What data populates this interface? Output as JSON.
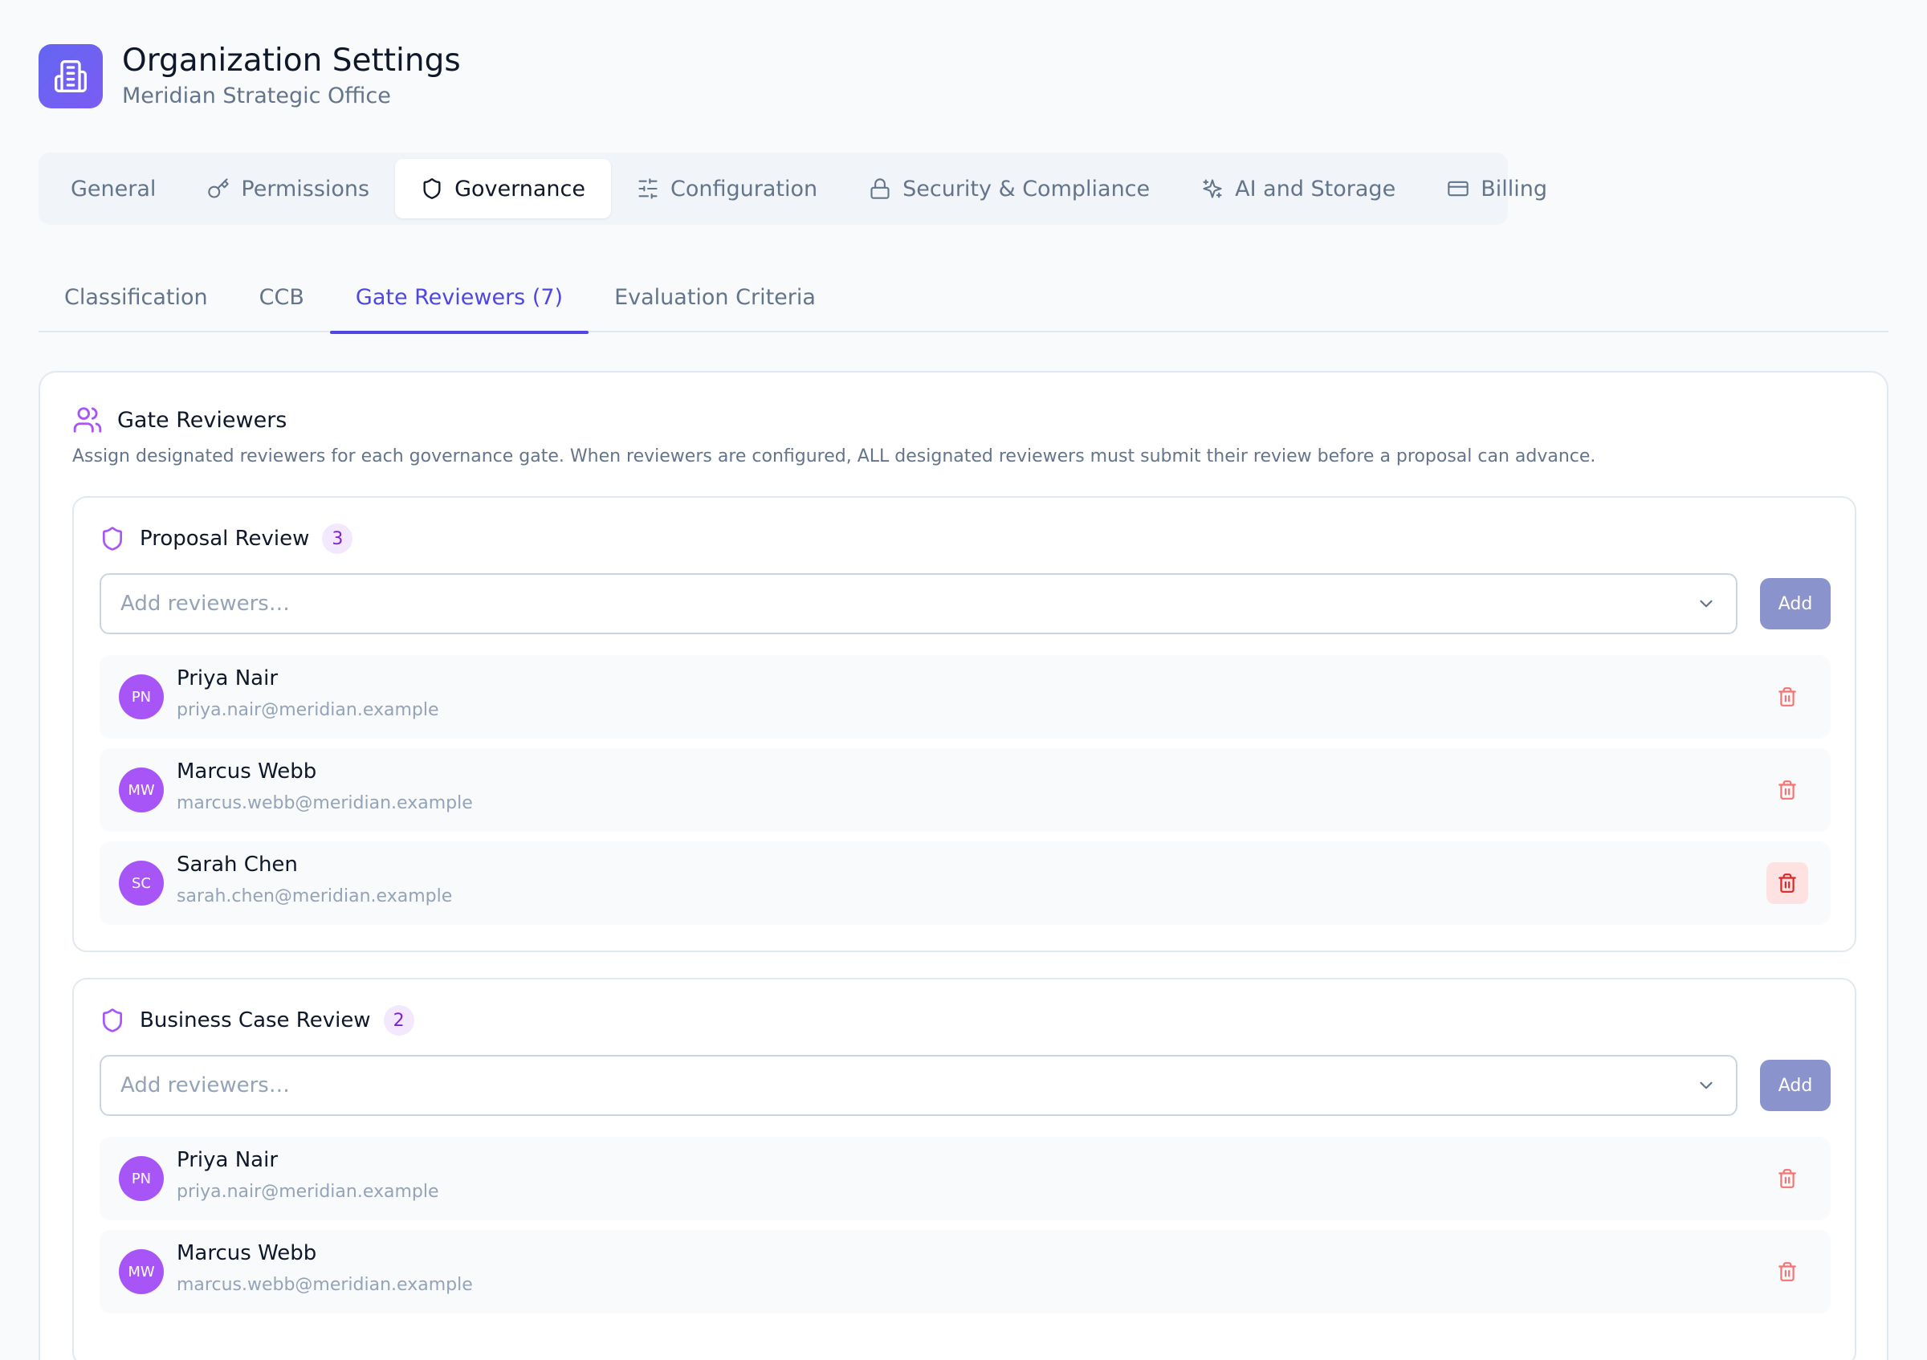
{
  "header": {
    "title": "Organization Settings",
    "subtitle": "Meridian Strategic Office",
    "icon": "building-icon",
    "accent": "#6366f1"
  },
  "main_tabs": [
    {
      "label": "General",
      "icon": ""
    },
    {
      "label": "Permissions",
      "icon": "key-icon"
    },
    {
      "label": "Governance",
      "icon": "shield-icon",
      "active": true
    },
    {
      "label": "Configuration",
      "icon": "sliders-icon"
    },
    {
      "label": "Security & Compliance",
      "icon": "lock-icon"
    },
    {
      "label": "AI and Storage",
      "icon": "sparkles-icon"
    },
    {
      "label": "Billing",
      "icon": "credit-card-icon"
    }
  ],
  "sub_tabs": [
    {
      "label": "Classification"
    },
    {
      "label": "CCB"
    },
    {
      "label": "Gate Reviewers (7)",
      "active": true
    },
    {
      "label": "Evaluation Criteria"
    }
  ],
  "card": {
    "title": "Gate Reviewers",
    "icon": "users-icon",
    "description": "Assign designated reviewers for each governance gate. When reviewers are configured, ALL designated reviewers must submit their review before a proposal can advance."
  },
  "gates": [
    {
      "title": "Proposal Review",
      "count": "3",
      "placeholder": "Add reviewers…",
      "add_label": "Add",
      "reviewers": [
        {
          "initials": "PN",
          "name": "Priya Nair",
          "email": "priya.nair@meridian.example"
        },
        {
          "initials": "MW",
          "name": "Marcus Webb",
          "email": "marcus.webb@meridian.example"
        },
        {
          "initials": "SC",
          "name": "Sarah Chen",
          "email": "sarah.chen@meridian.example"
        }
      ]
    },
    {
      "title": "Business Case Review",
      "count": "2",
      "placeholder": "Add reviewers…",
      "add_label": "Add",
      "reviewers": [
        {
          "initials": "PN",
          "name": "Priya Nair",
          "email": "priya.nair@meridian.example"
        },
        {
          "initials": "MW",
          "name": "Marcus Webb",
          "email": "marcus.webb@meridian.example"
        }
      ]
    }
  ],
  "colors": {
    "primary": "#4f46e5",
    "avatar": "#a855f7",
    "danger": "#ef4444",
    "add_button": "#8b93cc"
  }
}
